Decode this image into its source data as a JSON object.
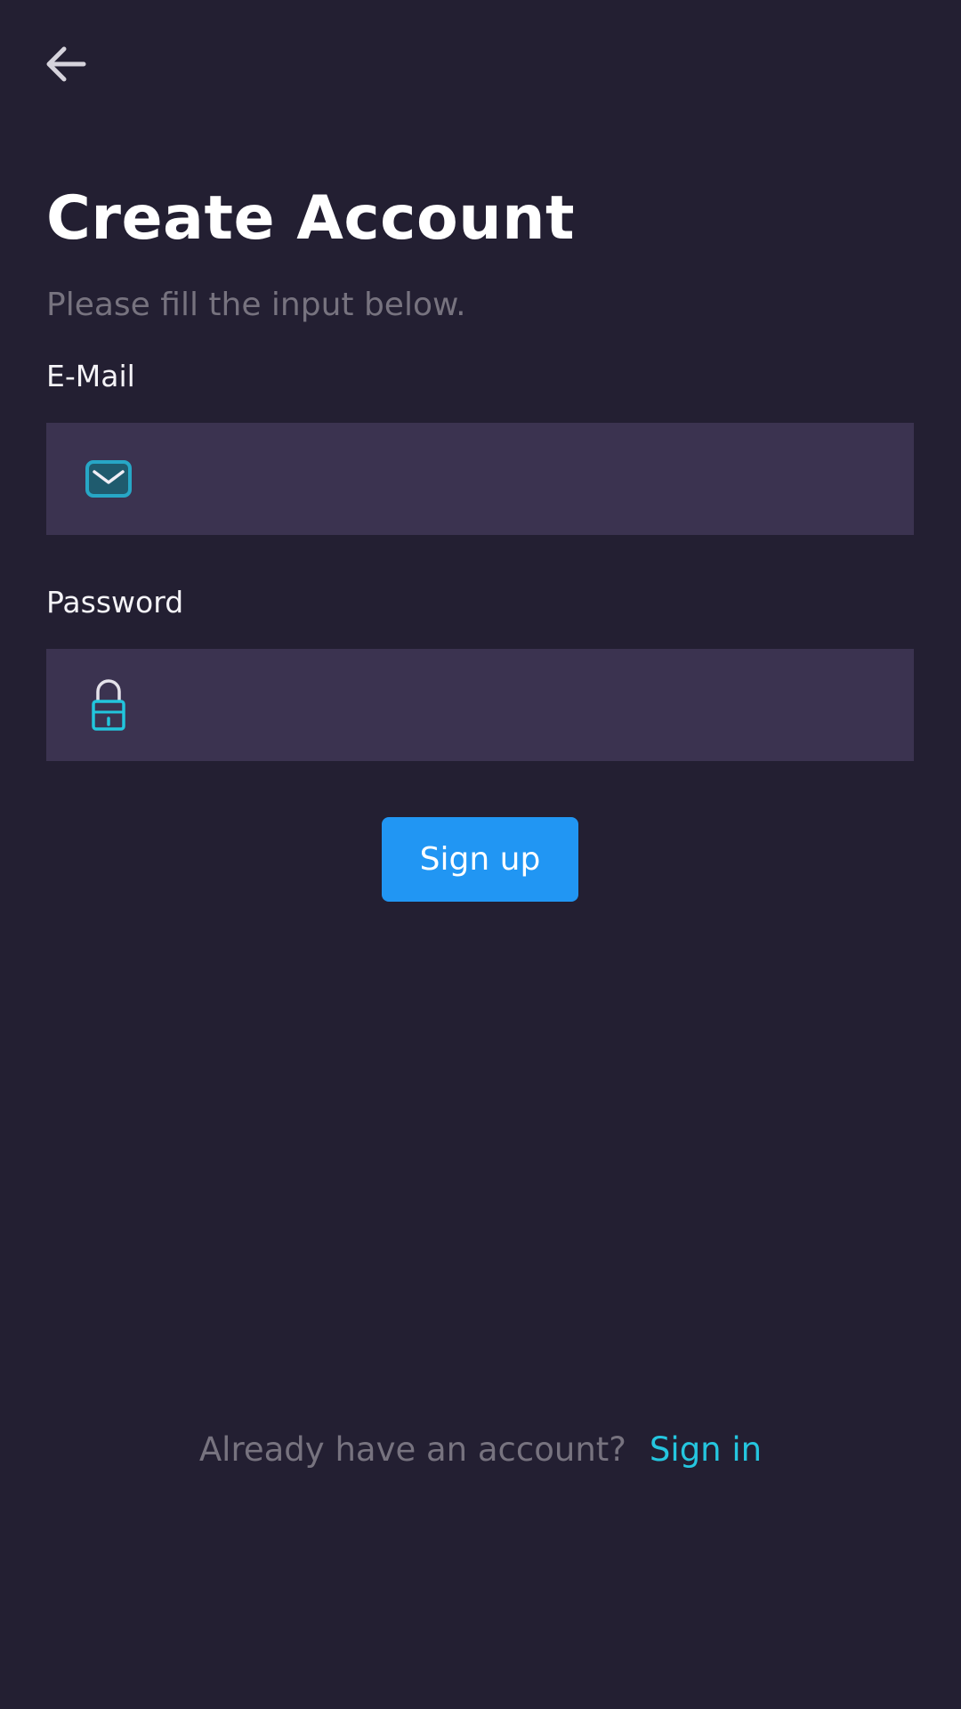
{
  "header": {
    "back_icon": "arrow-left-icon"
  },
  "title": "Create Account",
  "subtitle": "Please fill the input below.",
  "email": {
    "label": "E-Mail",
    "value": "",
    "placeholder": "",
    "icon": "envelope-icon"
  },
  "password": {
    "label": "Password",
    "value": "",
    "placeholder": "",
    "icon": "lock-icon"
  },
  "signup_button": {
    "label": "Sign up"
  },
  "footer": {
    "prompt": "Already have an account?",
    "link": "Sign in"
  },
  "colors": {
    "background": "#231F32",
    "input_background": "#3B3350",
    "primary_button": "#2196F3",
    "accent": "#25C6DF",
    "muted_text": "#77737F"
  }
}
